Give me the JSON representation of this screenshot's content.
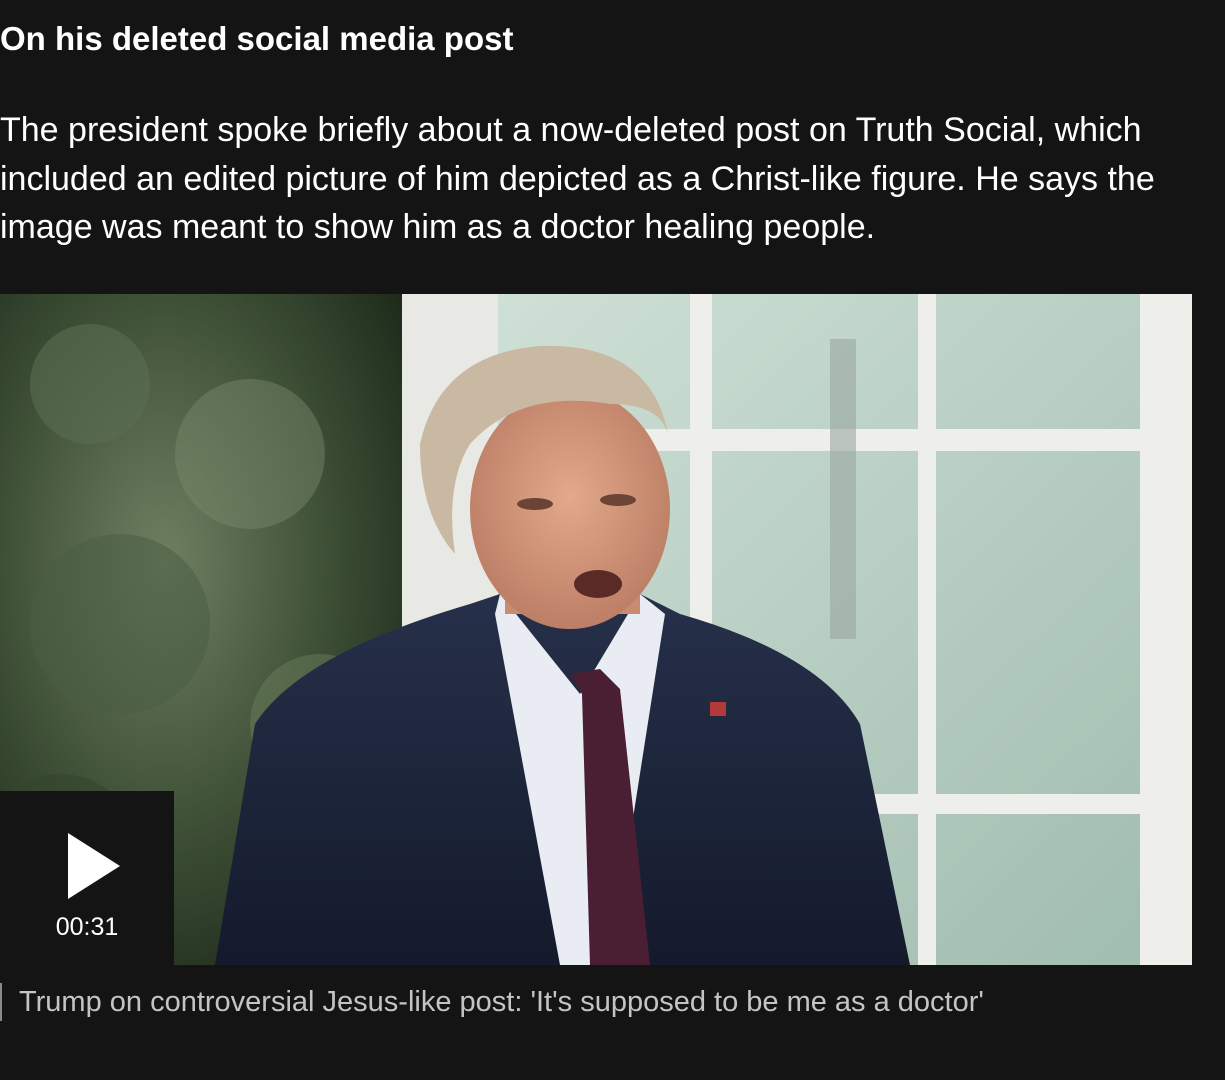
{
  "section": {
    "heading": "On his deleted social media post",
    "body": "The president spoke briefly about a now-deleted post on Truth Social, which included an edited picture of him depicted as a Christ-like figure. He says the image was meant to show him as a doctor healing people."
  },
  "video": {
    "duration": "00:31",
    "play_icon": "play-icon",
    "caption": "Trump on controversial Jesus-like post: 'It's supposed to be me as a doctor'"
  },
  "colors": {
    "background": "#141414",
    "text": "#ffffff",
    "caption_text": "#c4c4c4",
    "overlay": "#141414"
  }
}
